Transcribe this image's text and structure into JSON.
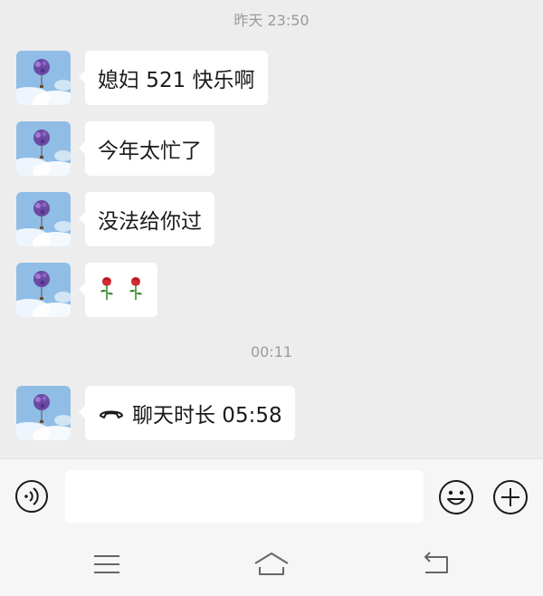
{
  "chat": {
    "timestamp_1": "昨天 23:50",
    "timestamp_2": "00:11",
    "messages": [
      {
        "type": "text",
        "text": "媳妇 521 快乐啊"
      },
      {
        "type": "text",
        "text": "今年太忙了"
      },
      {
        "type": "text",
        "text": "没法给你过"
      },
      {
        "type": "emoji",
        "emojis": [
          "🌹",
          "🌹"
        ]
      },
      {
        "type": "call",
        "text": "聊天时长 05:58",
        "icon": "phone-hangup-icon"
      }
    ]
  },
  "input_bar": {
    "voice_icon": "voice-icon",
    "text_value": "",
    "emoji_icon": "smiley-icon",
    "more_icon": "plus-icon"
  },
  "navbar": {
    "menu_icon": "menu-icon",
    "home_icon": "home-icon",
    "back_icon": "back-icon"
  },
  "colors": {
    "background": "#ededed",
    "bubble": "#ffffff",
    "rose": "#c4262e"
  }
}
